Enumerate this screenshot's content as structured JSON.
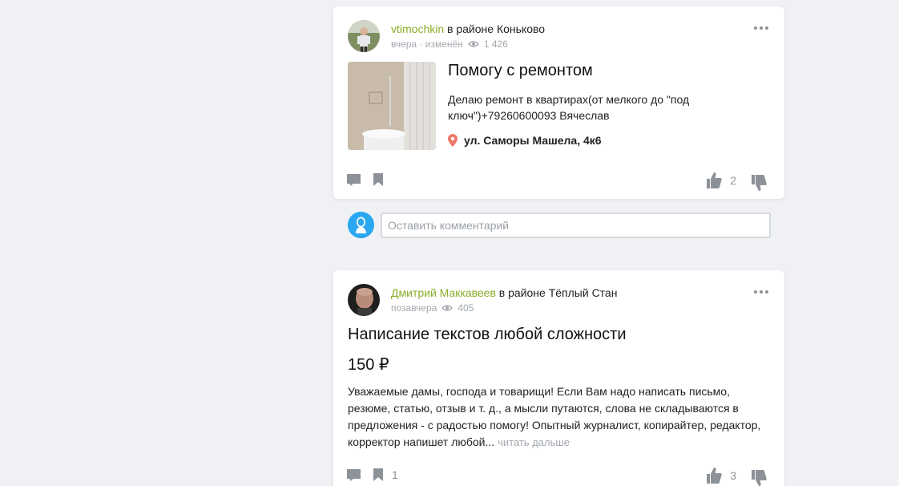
{
  "posts": [
    {
      "author": "vtimochkin",
      "location": "в районе Коньково",
      "time": "вчера",
      "edited": "изменён",
      "views": "1 426",
      "title": "Помогу с ремонтом",
      "description": "Делаю ремонт в квартирах(от мелкого до \"под ключ\")+79260600093 Вячеслав",
      "address": "ул. Саморы Машела, 4к6",
      "likes": "2",
      "bookmarks": ""
    },
    {
      "author": "Дмитрий Маккавеев",
      "location": "в районе Тёплый Стан",
      "time": "позавчера",
      "views": "405",
      "title": "Написание текстов любой сложности",
      "price": "150 ₽",
      "description": "Уважаемые дамы, господа и товарищи! Если Вам надо написать письмо, резюме, статью, отзыв и т. д., а мысли путаются, слова не складываются в предложения - с радостью помогу! Опытный журналист, копирайтер, редактор, корректор напишет любой...",
      "read_more": "читать дальше",
      "likes": "3",
      "bookmarks": "1"
    }
  ],
  "comment": {
    "placeholder": "Оставить комментарий"
  },
  "colors": {
    "author": "#8aae28",
    "background": "#eff1f4",
    "icon": "#8d9298",
    "pin": "#f0776b",
    "comment_avatar": "#2aa7ef"
  },
  "icons": {
    "meta": "eye-icon",
    "menu": "more-dots-icon",
    "address": "location-pin-icon",
    "comment": "comment-icon",
    "bookmark": "bookmark-icon",
    "like": "thumbs-up-icon",
    "dislike": "thumbs-down-icon"
  }
}
